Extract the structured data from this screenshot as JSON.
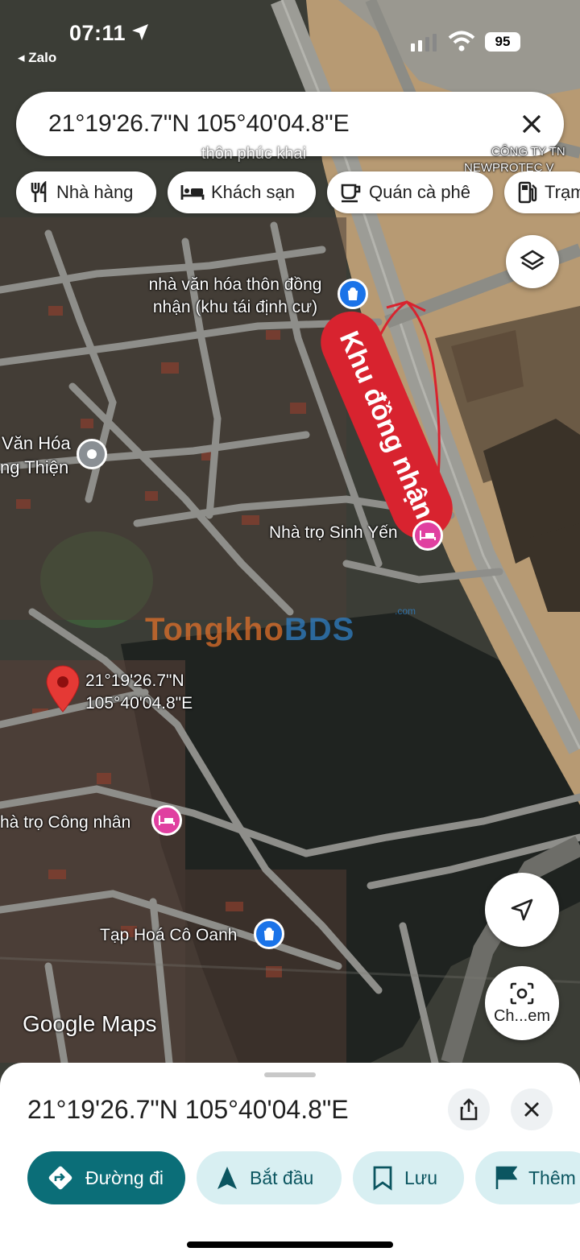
{
  "status_bar": {
    "time": "07:11",
    "back_app": "◂ Zalo",
    "battery": "95"
  },
  "search": {
    "query": "21°19'26.7\"N 105°40'04.8\"E",
    "close_icon": "close-icon"
  },
  "chips": [
    {
      "label": "Nhà hàng",
      "icon": "restaurant-icon"
    },
    {
      "label": "Khách sạn",
      "icon": "hotel-icon"
    },
    {
      "label": "Quán cà phê",
      "icon": "coffee-icon"
    },
    {
      "label": "Trạm",
      "icon": "gas-station-icon"
    }
  ],
  "map": {
    "labels": {
      "cultural_house": "nhà văn hóa thôn đồng nhận (khu tái định cư)",
      "van_hoa": "Văn Hóa",
      "thien": "ng Thiện",
      "sinh_yen": "Nhà trọ Sinh Yến",
      "pin_coord": "21°19'26.7\"N 105°40'04.8\"E",
      "cong_nhan": "hà trọ Công nhân",
      "tap_hoa": "Tạp Hoá Cô Oanh",
      "faded_top": "thôn phúc khai",
      "company": "CÔNG TY TN",
      "newprotec": "NEWPROTEC V"
    },
    "annotation": "Khu đồng nhận",
    "annotation_color": "#d8232f",
    "watermark": {
      "part1": "Tongkho",
      "part2": "BDS",
      "suffix": ".com"
    },
    "google_logo": "Google Maps"
  },
  "map_buttons": {
    "layers_icon": "layers-icon",
    "locate_icon": "navigation-arrow-icon",
    "lens_label": "Ch...em"
  },
  "sheet": {
    "title": "21°19'26.7\"N 105°40'04.8\"E",
    "actions": [
      {
        "label": "Đường đi",
        "icon": "directions-icon"
      },
      {
        "label": "Bắt đầu",
        "icon": "navigate-icon"
      },
      {
        "label": "Lưu",
        "icon": "bookmark-icon"
      },
      {
        "label": "Thêm",
        "icon": "flag-icon"
      }
    ]
  },
  "colors": {
    "accent": "#0b6e78",
    "accent_light": "#d8eff2",
    "pin": "#e53935",
    "hotel_pin": "#e040a0",
    "shop_pin": "#1a73e8"
  }
}
